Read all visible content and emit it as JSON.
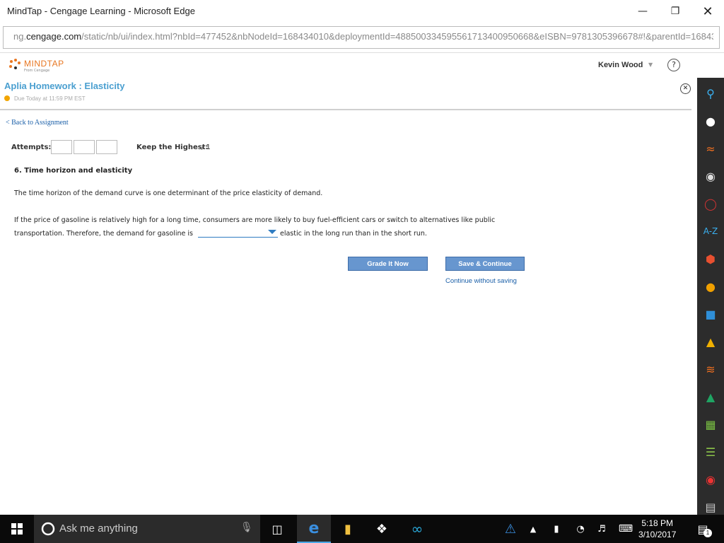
{
  "browser": {
    "title": "MindTap - Cengage Learning - Microsoft Edge",
    "url_prefix": "ng.",
    "url_host": "cengage.com",
    "url_rest": "/static/nb/ui/index.html?nbId=477452&nbNodeId=168434010&deploymentId=488500334595561713400950668&eISBN=9781305396678#!&parentId=16843"
  },
  "mindtap": {
    "logo_text": "MINDTAP",
    "logo_sub": "From Cengage",
    "user_name": "Kevin Wood",
    "help_label": "?"
  },
  "assignment": {
    "title": "Aplia Homework : Elasticity",
    "due": "Due Today at 11:59 PM EST",
    "back_label": "< Back to Assignment",
    "attempts_label": "Attempts:",
    "keep_label": "Keep the Highest:",
    "keep_value": "/ 1"
  },
  "question": {
    "title": "6. Time horizon and elasticity",
    "para1": "The time horizon of the demand curve is one determinant of the price elasticity of demand.",
    "para2": "If the price of gasoline is relatively high for a long time, consumers are more likely to buy fuel-efficient cars or switch to alternatives like public",
    "para3a": "transportation. Therefore, the demand for gasoline is",
    "para3b": "elastic in the long run than in the short run.",
    "dropdown_value": ""
  },
  "actions": {
    "grade": "Grade It Now",
    "save": "Save & Continue",
    "continue_without": "Continue without saving"
  },
  "taskbar": {
    "search_placeholder": "Ask me anything",
    "time": "5:18 PM",
    "date": "3/10/2017",
    "notification_count": "1"
  },
  "sidebar_icons": [
    "search-icon",
    "user-icon",
    "rss-icon",
    "disc-icon",
    "merriam-webster-icon",
    "a-z-icon",
    "cv-icon",
    "six-icon",
    "book-icon",
    "bookmark-icon",
    "audio-icon",
    "google-drive-icon",
    "cart-icon",
    "notes-icon",
    "grade-icon",
    "messages-icon"
  ],
  "colors": {
    "accent": "#4a9fd0",
    "button": "#6796cf",
    "link": "#1a5fa8",
    "logo": "#e87722"
  }
}
